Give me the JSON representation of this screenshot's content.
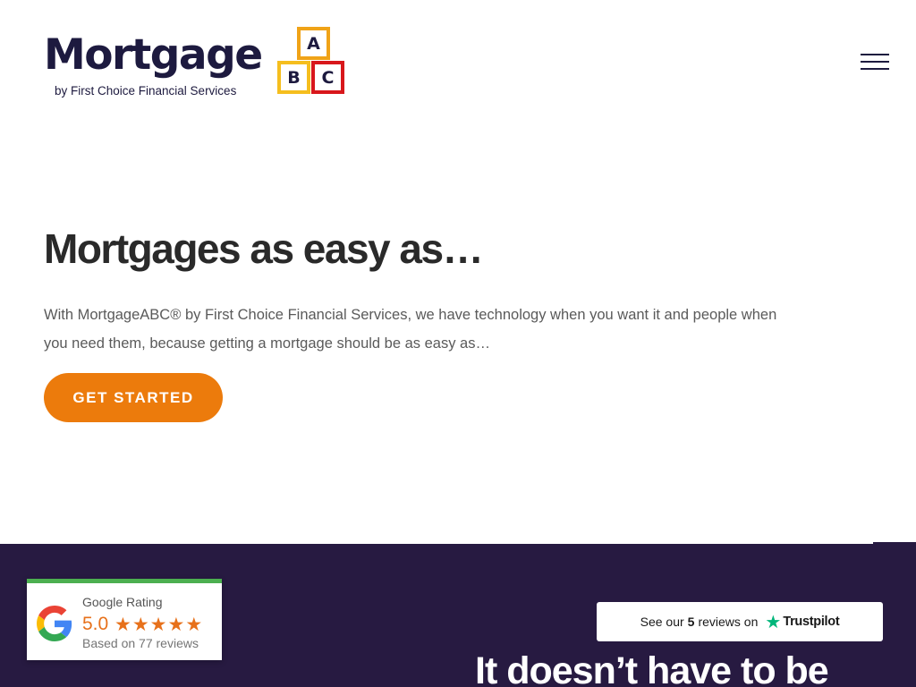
{
  "header": {
    "logo_word": "Mortgage",
    "logo_sub": "by First Choice Financial Services",
    "blocks": [
      "A",
      "B",
      "C"
    ],
    "menu_icon": "hamburger-menu-icon"
  },
  "hero": {
    "title": "Mortgages as easy as…",
    "text": "With MortgageABC® by First Choice Financial Services, we have technology when you want it and people when you need them, because getting a mortgage should be as easy as…",
    "cta_label": "GET STARTED"
  },
  "section": {
    "heading": "It doesn’t have to be"
  },
  "google_rating": {
    "title": "Google Rating",
    "score": "5.0",
    "stars": 5,
    "reviews": "Based on 77 reviews"
  },
  "trustpilot": {
    "prefix": "See our",
    "count": "5",
    "suffix": "reviews on",
    "brand": "Trustpilot"
  },
  "colors": {
    "brand_navy": "#1d1a3f",
    "accent_orange": "#ec7b0c",
    "section_bg": "#271a41",
    "block_a": "#f0a317",
    "block_b": "#f5be1e",
    "block_c": "#d8171b",
    "google_bar": "#4caf50",
    "star_orange": "#e7711b",
    "trustpilot_green": "#00b67a"
  }
}
